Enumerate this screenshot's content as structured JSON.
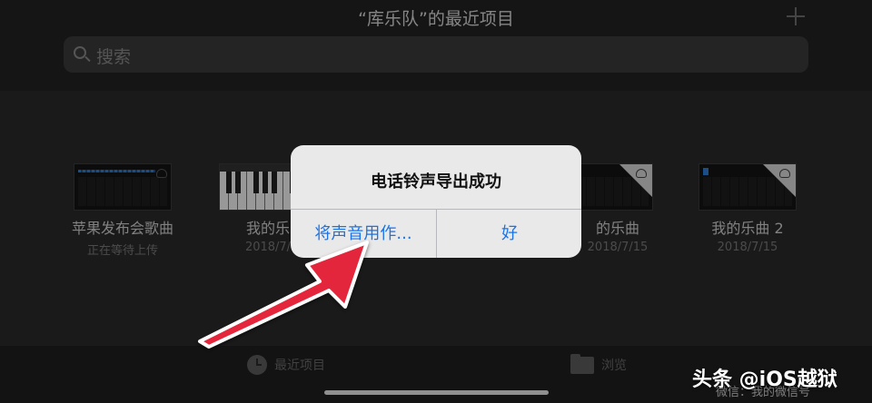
{
  "header": {
    "title": "“库乐队”的最近项目",
    "search_placeholder": "搜索",
    "add_icon": "plus-icon"
  },
  "projects": [
    {
      "name": "苹果发布会歌曲",
      "subtitle": "正在等待上传",
      "thumbnail": "tracks"
    },
    {
      "name": "我的乐",
      "subtitle": "2018/7/",
      "thumbnail": "piano"
    },
    {
      "name": "的乐曲",
      "subtitle": "2018/7/15",
      "thumbnail": "tracks"
    },
    {
      "name": "我的乐曲 2",
      "subtitle": "2018/7/15",
      "thumbnail": "tracks"
    }
  ],
  "tabbar": {
    "recent_label": "最近项目",
    "browse_label": "浏览"
  },
  "alert": {
    "title": "电话铃声导出成功",
    "use_sound_label": "将声音用作...",
    "ok_label": "好"
  },
  "watermark": {
    "main": "头条 @iOS越狱",
    "sub": "微信：我的微信号"
  },
  "colors": {
    "alert_button": "#1a73e8",
    "arrow": "#e3283b",
    "background": "#2a2a2a"
  }
}
